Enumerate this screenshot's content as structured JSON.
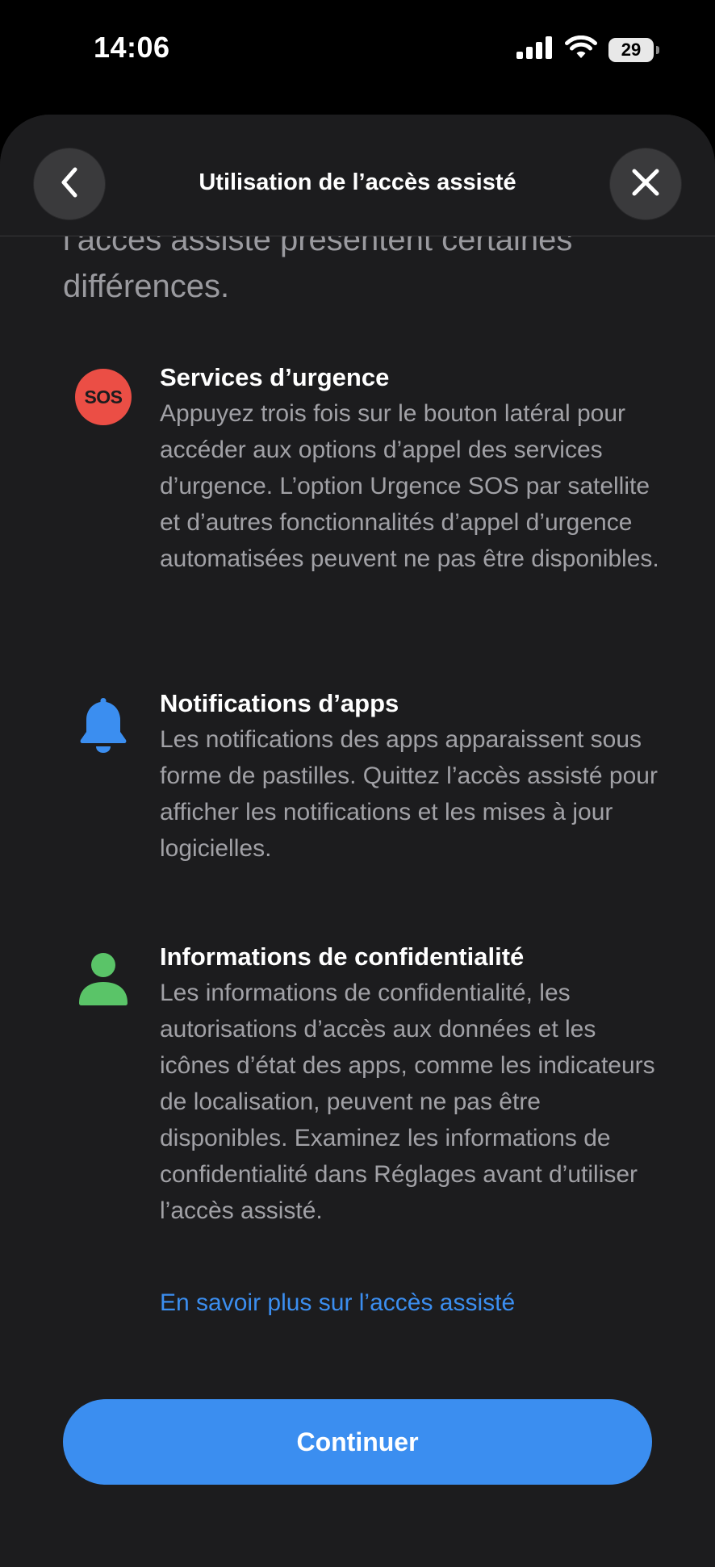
{
  "status_bar": {
    "time": "14:06",
    "battery": "29"
  },
  "header": {
    "title": "Utilisation de l’accès assisté",
    "back_icon": "chevron-left-icon",
    "close_icon": "close-icon"
  },
  "intro_text": "l’accès assisté présentent certaines différences.",
  "features": [
    {
      "icon": "sos-icon",
      "icon_label": "SOS",
      "title": "Services d’urgence",
      "body": "Appuyez trois fois sur le bouton latéral pour accéder aux options d’appel des services d’urgence. L’option Urgence SOS par satellite et d’autres fonctionnalités d’appel d’urgence automatisées peuvent ne pas être disponibles."
    },
    {
      "icon": "bell-icon",
      "title": "Notifications d’apps",
      "body": "Les notifications des apps apparaissent sous forme de pastilles. Quittez l’accès assisté pour afficher les notifications et les mises à jour logicielles."
    },
    {
      "icon": "person-icon",
      "title": "Informations de confidentialité",
      "body": "Les informations de confidentialité, les autorisations d’accès aux données et les icônes d’état des apps, comme les indicateurs de localisation, peuvent ne pas être disponibles. Examinez les informations de confidentialité dans Réglages avant d’utiliser l’accès assisté."
    }
  ],
  "learn_more_link": "En savoir plus sur l’accès assisté",
  "continue_button": "Continuer",
  "colors": {
    "accent": "#3b8ef0",
    "sos_red": "#eb4e45",
    "bell_blue": "#3b8ef0",
    "person_green": "#5ac468",
    "sheet_bg": "#1c1c1e"
  }
}
